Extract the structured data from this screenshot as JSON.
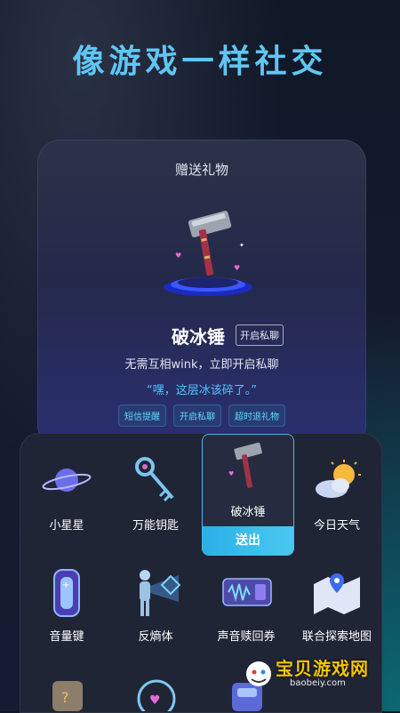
{
  "headline": "像游戏一样社交",
  "gift_card": {
    "title": "赠送礼物",
    "item_name": "破冰锤",
    "badge": "开启私聊",
    "description": "无需互相wink，立即开启私聊",
    "quote": "“嘿，这层冰该碎了。”",
    "tags": [
      "短信提醒",
      "开启私聊",
      "超时退礼物"
    ]
  },
  "gift_panel": {
    "send_label": "送出",
    "items": [
      {
        "name": "小星星",
        "icon": "planet-icon"
      },
      {
        "name": "万能钥匙",
        "icon": "key-icon"
      },
      {
        "name": "破冰锤",
        "icon": "hammer-icon",
        "selected": true
      },
      {
        "name": "今日天气",
        "icon": "weather-icon"
      },
      {
        "name": "音量键",
        "icon": "volume-key-icon"
      },
      {
        "name": "反熵体",
        "icon": "figure-icon"
      },
      {
        "name": "声音赎回券",
        "icon": "voucher-icon"
      },
      {
        "name": "联合探索地图",
        "icon": "map-icon"
      }
    ]
  },
  "watermark": {
    "text": "宝贝游戏网",
    "url": "baobeiy.com"
  },
  "colors": {
    "accent": "#4bc8f0",
    "headline": "#5fc6f3",
    "tag_text": "#5fd8ff"
  }
}
